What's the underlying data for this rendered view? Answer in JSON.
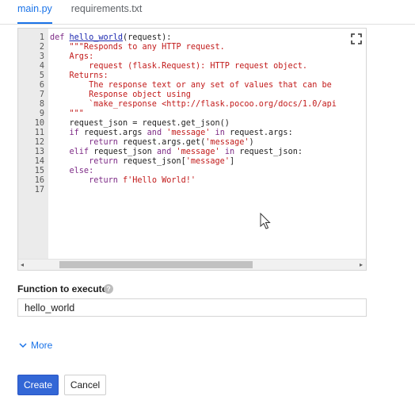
{
  "tabs": [
    {
      "label": "main.py",
      "active": true
    },
    {
      "label": "requirements.txt",
      "active": false
    }
  ],
  "editor": {
    "language": "python",
    "lines": [
      {
        "n": "1",
        "tokens": [
          {
            "t": "kw",
            "v": "def "
          },
          {
            "t": "fn",
            "v": "hello_world"
          },
          {
            "t": "pl",
            "v": "(request):"
          }
        ]
      },
      {
        "n": "2",
        "tokens": [
          {
            "t": "str",
            "v": "    \"\"\"Responds to any HTTP request."
          }
        ]
      },
      {
        "n": "3",
        "tokens": [
          {
            "t": "str",
            "v": "    Args:"
          }
        ]
      },
      {
        "n": "4",
        "tokens": [
          {
            "t": "str",
            "v": "        request (flask.Request): HTTP request object."
          }
        ]
      },
      {
        "n": "5",
        "tokens": [
          {
            "t": "str",
            "v": "    Returns:"
          }
        ]
      },
      {
        "n": "6",
        "tokens": [
          {
            "t": "str",
            "v": "        The response text or any set of values that can be"
          }
        ]
      },
      {
        "n": "7",
        "tokens": [
          {
            "t": "str",
            "v": "        Response object using"
          }
        ]
      },
      {
        "n": "8",
        "tokens": [
          {
            "t": "str",
            "v": "        `make_response <http://flask.pocoo.org/docs/1.0/api"
          }
        ]
      },
      {
        "n": "9",
        "tokens": [
          {
            "t": "str",
            "v": "    \"\"\""
          }
        ]
      },
      {
        "n": "10",
        "tokens": [
          {
            "t": "pl",
            "v": "    request_json = request.get_json()"
          }
        ]
      },
      {
        "n": "11",
        "tokens": [
          {
            "t": "kw",
            "v": "    if "
          },
          {
            "t": "pl",
            "v": "request.args "
          },
          {
            "t": "kw",
            "v": "and "
          },
          {
            "t": "str",
            "v": "'message'"
          },
          {
            "t": "kw",
            "v": " in "
          },
          {
            "t": "pl",
            "v": "request.args:"
          }
        ]
      },
      {
        "n": "12",
        "tokens": [
          {
            "t": "kw",
            "v": "        return "
          },
          {
            "t": "pl",
            "v": "request.args.get("
          },
          {
            "t": "str",
            "v": "'message'"
          },
          {
            "t": "pl",
            "v": ")"
          }
        ]
      },
      {
        "n": "13",
        "tokens": [
          {
            "t": "kw",
            "v": "    elif "
          },
          {
            "t": "pl",
            "v": "request_json "
          },
          {
            "t": "kw",
            "v": "and "
          },
          {
            "t": "str",
            "v": "'message'"
          },
          {
            "t": "kw",
            "v": " in "
          },
          {
            "t": "pl",
            "v": "request_json:"
          }
        ]
      },
      {
        "n": "14",
        "tokens": [
          {
            "t": "kw",
            "v": "        return "
          },
          {
            "t": "pl",
            "v": "request_json["
          },
          {
            "t": "str",
            "v": "'message'"
          },
          {
            "t": "pl",
            "v": "]"
          }
        ]
      },
      {
        "n": "15",
        "tokens": [
          {
            "t": "kw",
            "v": "    else:"
          }
        ]
      },
      {
        "n": "16",
        "tokens": [
          {
            "t": "kw",
            "v": "        return "
          },
          {
            "t": "str",
            "v": "f'Hello World!'"
          }
        ]
      },
      {
        "n": "17",
        "tokens": []
      }
    ],
    "fullscreen_icon": "fullscreen-icon",
    "scroll_left_icon": "◂",
    "scroll_right_icon": "▸"
  },
  "function_field": {
    "label": "Function to execute",
    "help_icon": "?",
    "value": "hello_world"
  },
  "more_link": "More",
  "buttons": {
    "create": "Create",
    "cancel": "Cancel"
  },
  "colors": {
    "accent": "#1a73e8",
    "create_button": "#3367d6",
    "keyword": "#7d2a86",
    "string": "#c21a1a",
    "function_name": "#1c28b0"
  }
}
